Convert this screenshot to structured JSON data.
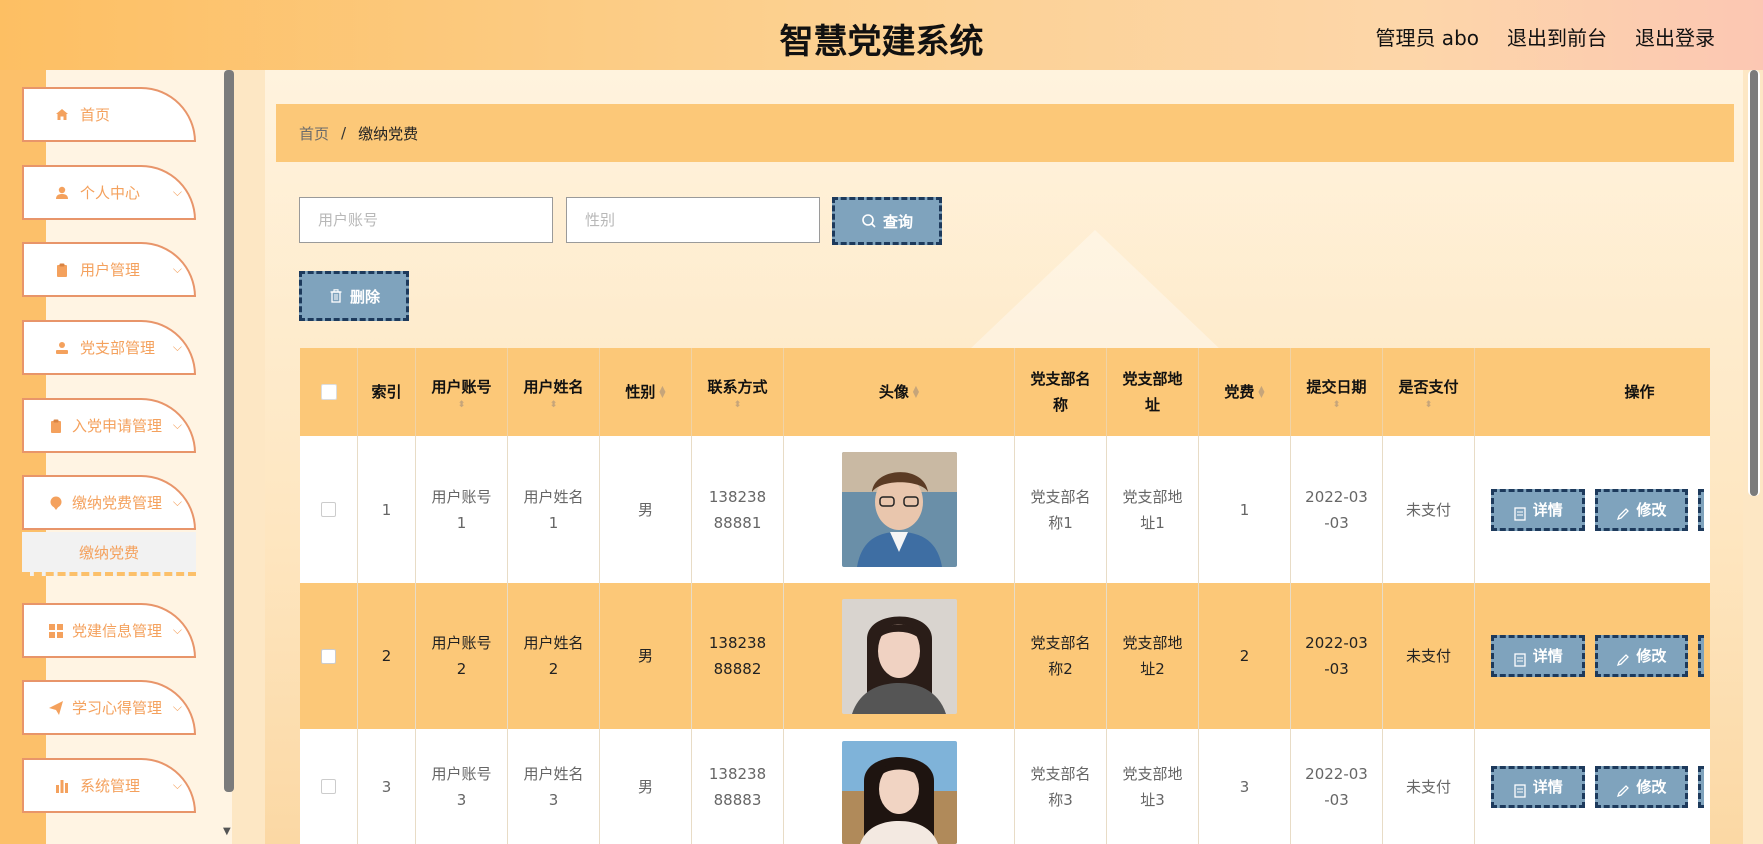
{
  "header": {
    "title": "智慧党建系统",
    "admin_label": "管理员 abo",
    "to_front": "退出到前台",
    "logout": "退出登录"
  },
  "sidebar": {
    "items": [
      {
        "label": "首页",
        "icon": "home-icon",
        "has_chevron": false
      },
      {
        "label": "个人中心",
        "icon": "user-icon",
        "has_chevron": true
      },
      {
        "label": "用户管理",
        "icon": "clipboard-icon",
        "has_chevron": true
      },
      {
        "label": "党支部管理",
        "icon": "person-icon",
        "has_chevron": true
      },
      {
        "label": "入党申请管理",
        "icon": "clipboard-icon",
        "has_chevron": true
      },
      {
        "label": "缴纳党费管理",
        "icon": "pin-icon",
        "has_chevron": true
      },
      {
        "label": "党建信息管理",
        "icon": "grid-icon",
        "has_chevron": true
      },
      {
        "label": "学习心得管理",
        "icon": "send-icon",
        "has_chevron": true
      },
      {
        "label": "系统管理",
        "icon": "bar-chart-icon",
        "has_chevron": true
      }
    ],
    "sub_item": "缴纳党费"
  },
  "breadcrumb": {
    "home": "首页",
    "separator": "/",
    "current": "缴纳党费"
  },
  "search": {
    "account_placeholder": "用户账号",
    "gender_placeholder": "性别",
    "query_button": "查询"
  },
  "toolbar": {
    "delete_button": "删除"
  },
  "table": {
    "columns": [
      "索引",
      "用户账号",
      "用户姓名",
      "性别",
      "联系方式",
      "头像",
      "党支部名称",
      "党支部地址",
      "党费",
      "提交日期",
      "是否支付",
      "操作"
    ],
    "rows": [
      {
        "index": "1",
        "account": "用户账号1",
        "name": "用户姓名1",
        "gender": "男",
        "phone": "13823888881",
        "branch": "党支部名称1",
        "address": "党支部地址1",
        "fee": "1",
        "date": "2022-03-03",
        "paid": "未支付"
      },
      {
        "index": "2",
        "account": "用户账号2",
        "name": "用户姓名2",
        "gender": "男",
        "phone": "13823888882",
        "branch": "党支部名称2",
        "address": "党支部地址2",
        "fee": "2",
        "date": "2022-03-03",
        "paid": "未支付"
      },
      {
        "index": "3",
        "account": "用户账号3",
        "name": "用户姓名3",
        "gender": "男",
        "phone": "13823888883",
        "branch": "党支部名称3",
        "address": "党支部地址3",
        "fee": "3",
        "date": "2022-03-03",
        "paid": "未支付"
      }
    ],
    "detail_button": "详情",
    "edit_button": "修改"
  },
  "colors": {
    "accent": "#fcc878",
    "button": "#7fa3bd",
    "button_border": "#1d3a5c",
    "sidebar_text": "#f4a15d"
  }
}
